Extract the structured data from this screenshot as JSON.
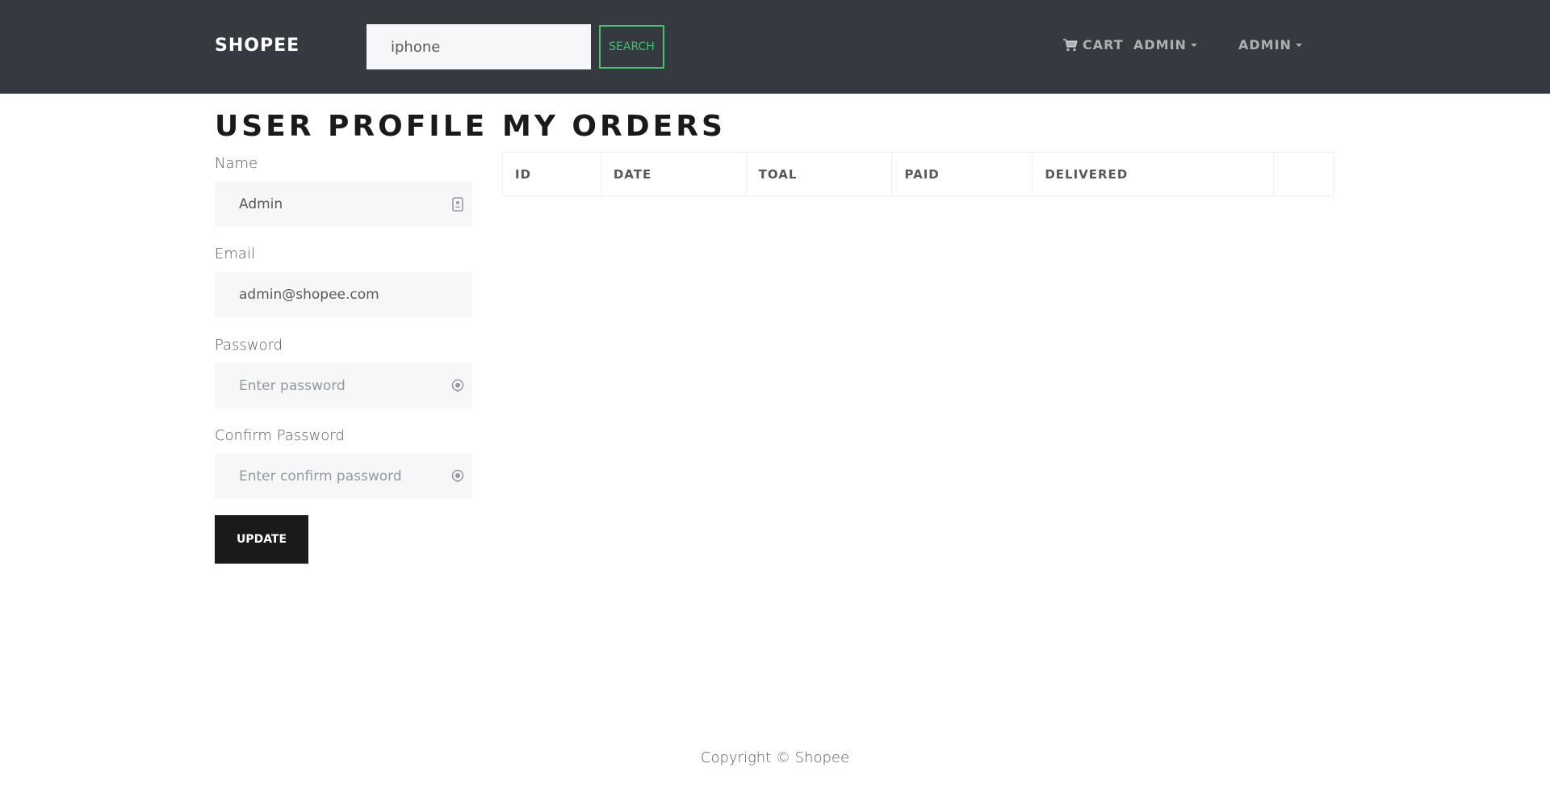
{
  "navbar": {
    "brand": "SHOPEE",
    "search": {
      "value": "iphone",
      "button_label": "SEARCH"
    },
    "cart_label": "CART",
    "user_menu_label": "ADMIN",
    "admin_menu_label": "ADMIN"
  },
  "profile": {
    "title": "USER PROFILE",
    "name_label": "Name",
    "name_value": "Admin",
    "email_label": "Email",
    "email_value": "admin@shopee.com",
    "password_label": "Password",
    "password_placeholder": "Enter password",
    "confirm_label": "Confirm Password",
    "confirm_placeholder": "Enter confirm password",
    "update_label": "UPDATE"
  },
  "orders": {
    "title": "MY ORDERS",
    "columns": [
      "ID",
      "DATE",
      "TOAL",
      "PAID",
      "DELIVERED",
      ""
    ]
  },
  "footer": {
    "text": "Copyright © Shopee"
  },
  "colors": {
    "navbar_bg": "#343a40",
    "accent_green": "#4bbf73",
    "button_dark": "#1a1a1a",
    "input_bg": "#f7f7f9"
  }
}
